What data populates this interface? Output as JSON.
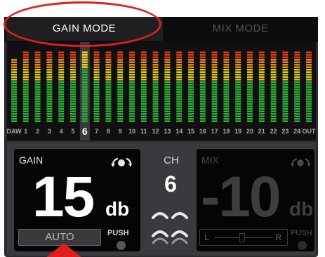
{
  "tabs": [
    {
      "label": "GAIN MODE",
      "active": true
    },
    {
      "label": "MIX MODE",
      "active": false
    }
  ],
  "meters": {
    "labels": [
      "DAW",
      "1",
      "2",
      "3",
      "4",
      "5",
      "6",
      "7",
      "8",
      "9",
      "10",
      "11",
      "12",
      "13",
      "14",
      "15",
      "16",
      "17",
      "18",
      "19",
      "20",
      "21",
      "22",
      "23",
      "24",
      "OUT"
    ],
    "selected_label": "6",
    "levels": [
      0.85,
      0.98,
      0.98,
      0.98,
      0.98,
      0.98,
      0.98,
      0.98,
      0.98,
      0.98,
      0.98,
      0.98,
      0.98,
      0.98,
      0.98,
      0.98,
      0.98,
      0.98,
      0.98,
      0.98,
      0.98,
      0.98,
      0.98,
      0.98,
      0.98,
      0.98
    ],
    "colors": {
      "green": "#2fa83a",
      "yellow": "#d9c51a",
      "orange": "#e0871f",
      "red": "#d93a1d",
      "selected": "#f2d21a"
    }
  },
  "gain_panel": {
    "title": "GAIN",
    "value": "15",
    "unit": "db",
    "auto_label": "AUTO",
    "push_label": "PUSH"
  },
  "channel": {
    "title": "CH",
    "value": "6"
  },
  "mix_panel": {
    "title": "MIX",
    "value": "-10",
    "unit": "db",
    "balance_left": "L",
    "balance_right": "R",
    "push_label": "PUSH"
  },
  "annotation_colors": {
    "highlight": "#e01e1e"
  }
}
